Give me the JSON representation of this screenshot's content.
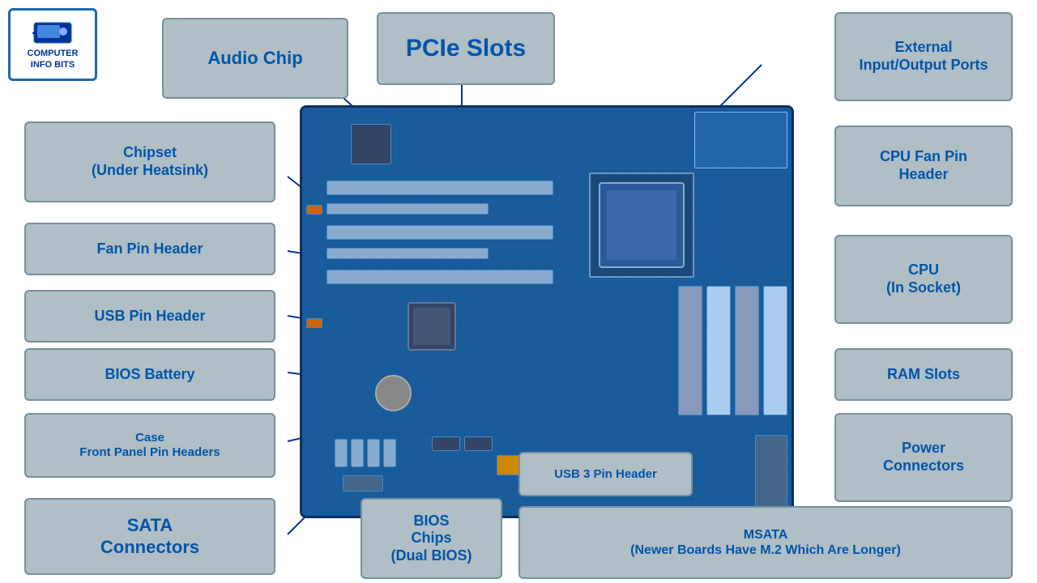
{
  "logo": {
    "line1": "COMPUTER",
    "line2": "INFO BITS"
  },
  "labels": {
    "audio_chip": "Audio Chip",
    "pcie_slots": "PCIe Slots",
    "external_io": "External\nInput/Output Ports",
    "chipset": "Chipset\n(Under Heatsink)",
    "cpu_fan": "CPU Fan Pin\nHeader",
    "fan_pin": "Fan Pin Header",
    "cpu": "CPU\n(In Socket)",
    "usb_pin": "USB Pin Header",
    "bios_battery": "BIOS Battery",
    "ram_slots": "RAM Slots",
    "case_front": "Case\nFront Panel Pin Headers",
    "power_conn": "Power\nConnectors",
    "sata": "SATA\nConnectors",
    "bios_chips": "BIOS\nChips\n(Dual BIOS)",
    "usb3": "USB 3 Pin Header",
    "msata": "MSATA\n(Newer Boards Have M.2 Which Are Longer)"
  }
}
